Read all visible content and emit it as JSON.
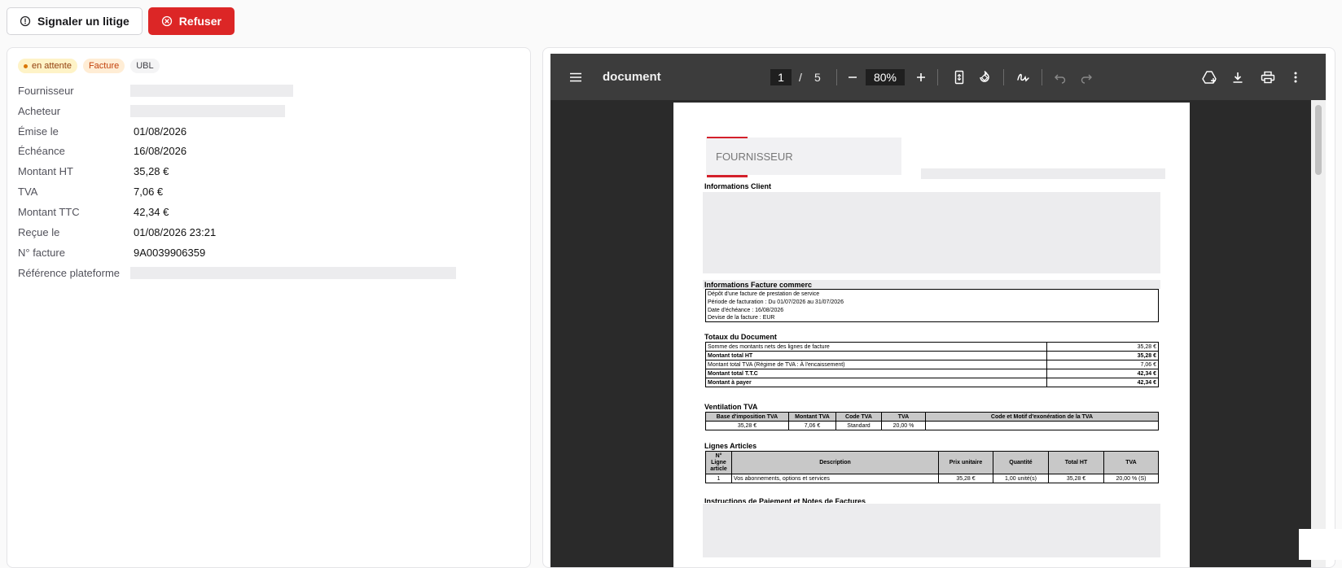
{
  "actions": {
    "dispute_label": "Signaler un litige",
    "refuse_label": "Refuser"
  },
  "badges": {
    "status": "en attente",
    "type": "Facture",
    "format": "UBL"
  },
  "details": {
    "supplier_label": "Fournisseur",
    "buyer_label": "Acheteur",
    "issued_label": "Émise le",
    "issued_value": "01/08/2026",
    "due_label": "Échéance",
    "due_value": "16/08/2026",
    "ht_label": "Montant HT",
    "ht_value": "35,28 €",
    "tva_label": "TVA",
    "tva_value": "7,06 €",
    "ttc_label": "Montant TTC",
    "ttc_value": "42,34 €",
    "received_label": "Reçue le",
    "received_value": "01/08/2026 23:21",
    "invoice_no_label": "N° facture",
    "invoice_no_value": "9A0039906359",
    "platform_ref_label": "Référence plateforme"
  },
  "viewer": {
    "doc_title": "document",
    "current_page": "1",
    "page_sep": "/",
    "total_pages": "5",
    "zoom": "80%"
  },
  "document": {
    "supplier_placeholder": "FOURNISSEUR",
    "client_info_title": "Informations Client",
    "invoice_info_title": "Informations Facture commerc",
    "invoice_info_lines": [
      "Dépôt d'une facture de prestation de service",
      "Période de facturation : Du 01/07/2026 au 31/07/2026",
      "Date d'échéance : 16/08/2026",
      "Devise de la facture : EUR"
    ],
    "totals_title": "Totaux du Document",
    "totals": [
      {
        "label": "Somme des montants nets des lignes de facture",
        "value": "35,28 €",
        "bold": false
      },
      {
        "label": "Montant total HT",
        "value": "35,28 €",
        "bold": true
      },
      {
        "label": "Montant total TVA (Régime de TVA : À l'encaissement)",
        "value": "7,06 €",
        "bold": false
      },
      {
        "label": "Montant total T.T.C",
        "value": "42,34 €",
        "bold": true
      },
      {
        "label": "Montant à payer",
        "value": "42,34 €",
        "bold": true
      }
    ],
    "vat_title": "Ventilation TVA",
    "vat_headers": [
      "Base d'imposition TVA",
      "Montant TVA",
      "Code TVA",
      "TVA",
      "Code et Motif d'exonération de la TVA"
    ],
    "vat_row": [
      "35,28 €",
      "7,06 €",
      "Standard",
      "20,00 %",
      ""
    ],
    "lines_title": "Lignes Articles",
    "lines_headers": [
      "N° Ligne article",
      "Description",
      "Prix unitaire",
      "Quantité",
      "Total HT",
      "TVA"
    ],
    "lines_row": [
      "1",
      "Vos abonnements, options et services",
      "35,28 €",
      "1,00 unité(s)",
      "35,28 €",
      "20,00 % (S)"
    ],
    "payment_title": "Instructions de Paiement et Notes de Factures"
  },
  "icons": {
    "dispute": "alert-circle-icon",
    "refuse": "x-circle-icon"
  },
  "colors": {
    "danger": "#dc2626",
    "accent_red": "#d4202b",
    "viewer_toolbar": "#3c3c3c"
  }
}
